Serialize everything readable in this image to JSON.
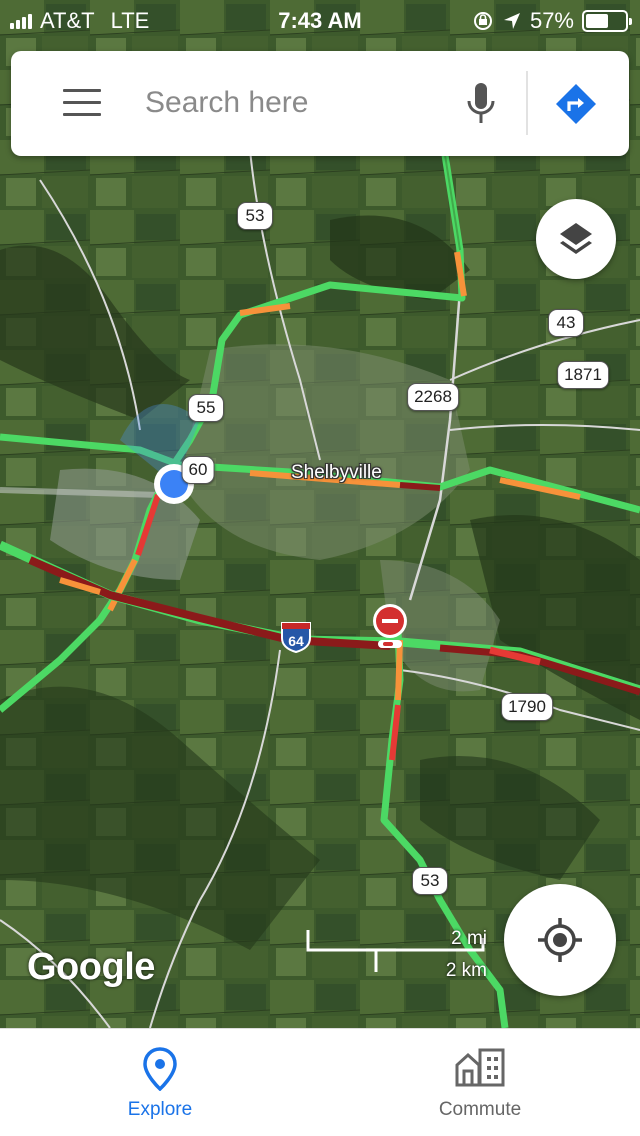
{
  "status_bar": {
    "carrier": "AT&T",
    "network": "LTE",
    "time": "7:43 AM",
    "battery": "57%",
    "battery_level": 0.57,
    "icons": [
      "signal-icon",
      "rotation-lock-icon",
      "location-arrow-icon",
      "battery-icon"
    ]
  },
  "search": {
    "placeholder": "Search here",
    "icons": [
      "menu-icon",
      "microphone-icon",
      "directions-icon"
    ]
  },
  "map": {
    "place_label": "Shelbyville",
    "route_shields": [
      "53",
      "55",
      "60",
      "43",
      "1871",
      "2268",
      "1790",
      "53"
    ],
    "interstate": "64",
    "traffic_colors": {
      "clear": "#4cd964",
      "slow": "#f7923a",
      "heavy": "#e53935",
      "stopped": "#8b1a1a"
    },
    "scale": {
      "imperial": "2 mi",
      "metric": "2 km"
    },
    "attribution": "Google"
  },
  "controls": {
    "layers": "layers-icon",
    "my_location": "my-location-icon"
  },
  "bottom_nav": {
    "explore": "Explore",
    "commute": "Commute",
    "active": "explore"
  }
}
